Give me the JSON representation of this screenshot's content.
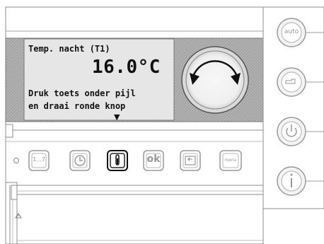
{
  "display": {
    "line1": "Temp. nacht (T1)",
    "temperature": "16.0°C",
    "line3": "Druk toets onder pijl",
    "line4": "en draai ronde knop",
    "arrow": "▼"
  },
  "keys": {
    "program_label": "1...7",
    "clock_icon": "clock-icon",
    "thermometer_icon": "thermometer-icon",
    "ok_label": "ok",
    "back_icon": "return-icon",
    "menu_label": "menu"
  },
  "side_buttons": {
    "auto_label": "auto",
    "hand_icon": "hand-icon",
    "power_icon": "power-icon",
    "info_icon": "info-icon"
  },
  "colors": {
    "panel_stripe": "#9a9a9a",
    "lcd_bg": "#e6e6e6",
    "outline": "#8c8c8c",
    "active_key": "#111111"
  }
}
